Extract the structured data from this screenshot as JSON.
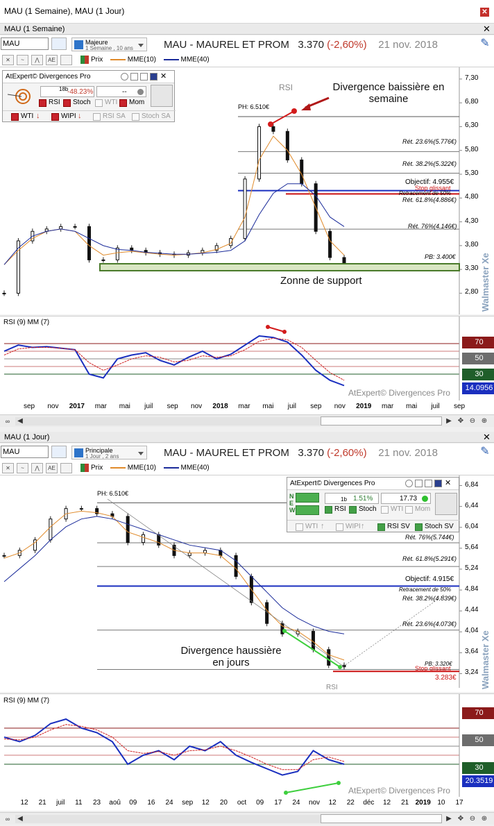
{
  "window": {
    "title": "MAU (1 Semaine), MAU (1 Jour)"
  },
  "weekly": {
    "panel_title": "MAU (1 Semaine)",
    "symbol": "MAU",
    "period_main": "Majeure",
    "period_sub": "1 Semaine , 10 ans",
    "chart_title": "MAU - MAUREL ET PROM",
    "price": "3.370",
    "change": "(-2,60%)",
    "date": "21 nov. 2018",
    "legend": {
      "prix": "Prix",
      "mme10": "MME(10)",
      "mme40": "MME(40)"
    },
    "y_ticks": [
      "7,30",
      "6,80",
      "6,30",
      "5,80",
      "5,30",
      "4,80",
      "4,30",
      "3,80",
      "3,30",
      "2,80"
    ],
    "x_ticks": [
      "sep",
      "nov",
      "2017",
      "mar",
      "mai",
      "juil",
      "sep",
      "nov",
      "2018",
      "mar",
      "mai",
      "juil",
      "sep",
      "nov",
      "2019",
      "mar",
      "mai",
      "juil",
      "sep"
    ],
    "ph_label": "PH: 6.510€",
    "pb_label": "PB: 3.400€",
    "levels": {
      "ret236": "Rét. 23.6%(5.776€)",
      "ret382": "Rét. 38.2%(5.322€)",
      "objectif": "Objectif: 4.955€",
      "stop": "Stop glissant",
      "retracement": "Retracement de 50%",
      "ret618": "Rét. 61.8%(4.886€)",
      "ret76": "Rét. 76%(4.146€)"
    },
    "rsi_marker": "RSI",
    "annotation_div": "Divergence baissière en semaine",
    "annotation_support": "Zonne de support",
    "rsi_title": "RSI (9) MM (7)",
    "rsi_levels": [
      "70",
      "50",
      "30"
    ],
    "rsi_value": "14.0956",
    "watermark": "AtExpert© Divergences Pro",
    "vendor": "Walmaster Xe",
    "atexpert": {
      "title": "AtExpert© Divergences Pro",
      "periods": "18b",
      "pct": "-48.23%",
      "dash": "--",
      "checks": [
        {
          "label": "RSI",
          "on": true
        },
        {
          "label": "Stoch",
          "on": true
        },
        {
          "label": "WTI",
          "on": false
        },
        {
          "label": "Mom",
          "on": true
        }
      ],
      "checks2": [
        {
          "label": "WTI",
          "on": true
        },
        {
          "label": "WIPI",
          "on": true
        },
        {
          "label": "RSI SA",
          "on": false
        },
        {
          "label": "Stoch SA",
          "on": false
        }
      ]
    },
    "chart_data": {
      "type": "line",
      "title": "MAU - MAUREL ET PROM (1 Semaine)",
      "ylim": [
        2.5,
        7.4
      ],
      "series": [
        {
          "name": "Prix",
          "values": [
            2.8,
            3.9,
            4.1,
            4.15,
            4.2,
            4.2,
            3.5,
            3.5,
            3.75,
            3.7,
            3.65,
            3.62,
            3.6,
            3.65,
            3.7,
            3.8,
            3.95,
            5.2,
            6.3,
            6.2,
            5.6,
            5.1,
            4.1,
            3.55,
            3.37
          ]
        },
        {
          "name": "MME(10)",
          "values": [
            3.4,
            3.7,
            3.95,
            4.1,
            4.15,
            4.1,
            3.8,
            3.6,
            3.65,
            3.68,
            3.65,
            3.62,
            3.6,
            3.62,
            3.65,
            3.72,
            3.85,
            4.4,
            5.6,
            6.1,
            5.8,
            5.3,
            4.6,
            3.9,
            3.6
          ]
        },
        {
          "name": "MME(40)",
          "values": [
            3.4,
            3.75,
            4.0,
            4.1,
            4.15,
            4.1,
            3.95,
            3.8,
            3.72,
            3.7,
            3.66,
            3.64,
            3.62,
            3.62,
            3.64,
            3.66,
            3.7,
            3.9,
            4.45,
            4.9,
            5.1,
            5.1,
            4.85,
            4.4,
            4.2
          ]
        }
      ]
    },
    "rsi_data": {
      "type": "line",
      "ylim": [
        0,
        100
      ],
      "series": [
        {
          "name": "RSI",
          "values": [
            60,
            68,
            65,
            66,
            64,
            62,
            30,
            25,
            50,
            55,
            58,
            48,
            42,
            52,
            60,
            50,
            56,
            68,
            80,
            78,
            72,
            55,
            35,
            22,
            15
          ]
        },
        {
          "name": "MM",
          "values": [
            55,
            63,
            65,
            65,
            64,
            62,
            45,
            35,
            42,
            50,
            54,
            52,
            46,
            48,
            54,
            52,
            54,
            62,
            73,
            77,
            75,
            65,
            48,
            32,
            22
          ]
        }
      ]
    }
  },
  "daily": {
    "panel_title": "MAU (1 Jour)",
    "symbol": "MAU",
    "period_main": "Principale",
    "period_sub": "1 Jour , 2 ans",
    "chart_title": "MAU - MAUREL ET PROM",
    "price": "3.370",
    "change": "(-2,60%)",
    "date": "21 nov. 2018",
    "legend": {
      "prix": "Prix",
      "mme10": "MME(10)",
      "mme40": "MME(40)"
    },
    "y_ticks": [
      "6,84",
      "6,44",
      "6,04",
      "5,64",
      "5,24",
      "4,84",
      "4,44",
      "4,04",
      "3,64",
      "3,24"
    ],
    "x_ticks": [
      "12",
      "21",
      "juil",
      "11",
      "23",
      "aoû",
      "09",
      "16",
      "24",
      "sep",
      "12",
      "20",
      "oct",
      "09",
      "17",
      "24",
      "nov",
      "12",
      "22",
      "déc",
      "12",
      "21",
      "2019",
      "10",
      "17"
    ],
    "ph_label": "PH: 6.510€",
    "pb_label": "PB: 3.320€",
    "levels": {
      "ret76": "Rét. 76%(5.744€)",
      "ret618": "Rét. 61.8%(5.291€)",
      "objectif": "Objectif: 4.915€",
      "retracement": "Retracement de 50%",
      "ret382": "Rét. 38.2%(4.839€)",
      "ret236": "Rét. 23.6%(4.073€)",
      "stop": "Stop glissant",
      "stop_value": "3.283€"
    },
    "rsi_marker": "RSI",
    "annotation_div": "Divergence haussière en jours",
    "rsi_title": "RSI (9) MM (7)",
    "rsi_levels": [
      "70",
      "50",
      "30"
    ],
    "rsi_value": "20.3519",
    "watermark": "AtExpert© Divergences Pro",
    "vendor": "Walmaster Xe",
    "atexpert": {
      "title": "AtExpert© Divergences Pro",
      "nlabel": "N",
      "elabel": "E",
      "wlabel": "W",
      "periods": "1b",
      "pct": "1.51%",
      "val": "17.73",
      "checks": [
        {
          "label": "RSI",
          "on": true
        },
        {
          "label": "Stoch",
          "on": true
        },
        {
          "label": "WTI",
          "on": false
        },
        {
          "label": "Mom",
          "on": false
        }
      ],
      "checks2": [
        {
          "label": "WTI",
          "on": false
        },
        {
          "label": "WIPI",
          "on": false
        },
        {
          "label": "RSI SV",
          "on": true
        },
        {
          "label": "Stoch SV",
          "on": true
        }
      ]
    },
    "chart_data": {
      "type": "line",
      "title": "MAU - MAUREL ET PROM (1 Jour)",
      "ylim": [
        3.1,
        6.9
      ],
      "series": [
        {
          "name": "Prix",
          "values": [
            5.5,
            5.6,
            5.8,
            6.2,
            6.4,
            6.4,
            6.3,
            6.25,
            5.75,
            5.9,
            5.7,
            5.5,
            5.55,
            5.6,
            5.5,
            5.1,
            4.6,
            4.2,
            4.0,
            4.05,
            3.7,
            3.4,
            3.37
          ]
        },
        {
          "name": "MME(10)",
          "values": [
            5.45,
            5.55,
            5.75,
            6.05,
            6.3,
            6.35,
            6.32,
            6.25,
            5.95,
            5.85,
            5.75,
            5.6,
            5.55,
            5.55,
            5.5,
            5.25,
            4.85,
            4.45,
            4.15,
            4.05,
            3.85,
            3.6,
            3.5
          ]
        },
        {
          "name": "MME(40)",
          "values": [
            5.0,
            5.25,
            5.5,
            5.8,
            6.05,
            6.2,
            6.25,
            6.2,
            6.1,
            6.0,
            5.9,
            5.8,
            5.7,
            5.65,
            5.6,
            5.4,
            5.1,
            4.8,
            4.5,
            4.3,
            4.15,
            4.05,
            4.0
          ]
        }
      ]
    },
    "rsi_data": {
      "type": "line",
      "ylim": [
        0,
        100
      ],
      "series": [
        {
          "name": "RSI",
          "values": [
            60,
            55,
            62,
            75,
            80,
            70,
            65,
            55,
            30,
            40,
            45,
            35,
            50,
            45,
            55,
            40,
            32,
            25,
            18,
            22,
            45,
            35,
            30
          ]
        },
        {
          "name": "MM",
          "values": [
            58,
            57,
            60,
            68,
            74,
            72,
            68,
            60,
            45,
            42,
            44,
            40,
            45,
            46,
            50,
            45,
            38,
            30,
            24,
            24,
            35,
            38,
            33
          ]
        }
      ]
    }
  }
}
